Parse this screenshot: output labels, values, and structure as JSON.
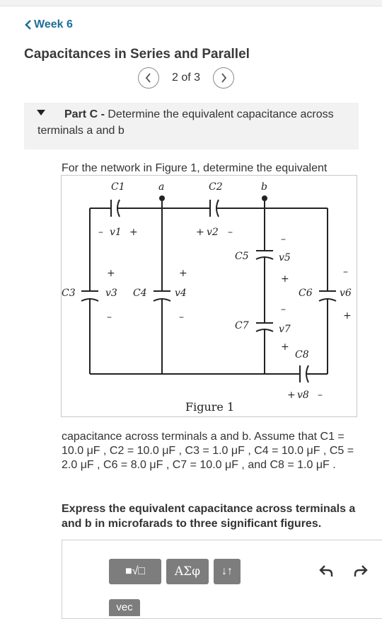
{
  "nav": {
    "back_label": "Week 6"
  },
  "page": {
    "title": "Capacitances in Series and Parallel"
  },
  "pager": {
    "label": "2 of 3"
  },
  "part": {
    "label": "Part C -",
    "description": "Determine the equivalent capacitance across terminals a and b"
  },
  "question": {
    "intro": "For the network in Figure 1, determine the equivalent",
    "continuation": "capacitance across terminals a and b. Assume that C1 = 10.0 μF , C2 = 10.0 μF , C3 = 1.0 μF , C4 = 10.0 μF , C5 = 2.0 μF , C6 = 8.0 μF , C7 = 10.0 μF , and C8 = 1.0 μF .",
    "instruction": "Express the equivalent capacitance across terminals a and b in microfarads to three significant figures."
  },
  "figure": {
    "caption": "Figure 1",
    "terminal_a": "a",
    "terminal_b": "b",
    "capacitors": [
      "C1",
      "C2",
      "C3",
      "C4",
      "C5",
      "C6",
      "C7",
      "C8"
    ],
    "voltages": [
      "v1",
      "v2",
      "v3",
      "v4",
      "v5",
      "v6",
      "v7",
      "v8"
    ],
    "plus": "+",
    "minus": "–"
  },
  "toolbar": {
    "template_label": "■√□",
    "greek_label": "ΑΣφ",
    "sort_label": "↓↑",
    "vec_label": "vec"
  }
}
